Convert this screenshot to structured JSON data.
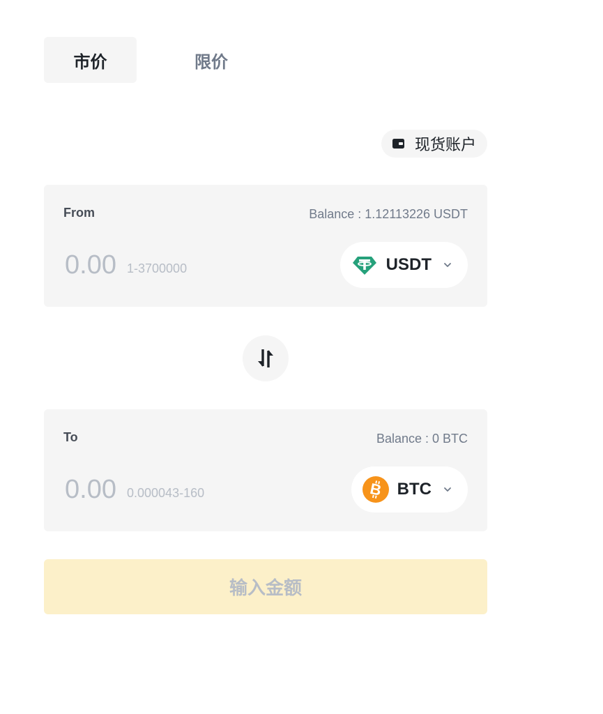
{
  "tabs": [
    {
      "label": "市价",
      "active": true
    },
    {
      "label": "限价",
      "active": false
    }
  ],
  "account": {
    "label": "现货账户",
    "icon": "wallet-icon"
  },
  "from": {
    "label": "From",
    "balance": "Balance : 1.12113226 USDT",
    "amount_placeholder": "0.00",
    "range": "1-3700000",
    "coin": "USDT",
    "coin_icon": "tether-icon",
    "coin_color": "#26a17b"
  },
  "to": {
    "label": "To",
    "balance": "Balance : 0 BTC",
    "amount_placeholder": "0.00",
    "range": "0.000043-160",
    "coin": "BTC",
    "coin_icon": "bitcoin-icon",
    "coin_color": "#f7931a"
  },
  "swap": {
    "icon": "swap-arrows-icon"
  },
  "submit": {
    "label": "输入金额",
    "background": "#fcf0c9"
  }
}
